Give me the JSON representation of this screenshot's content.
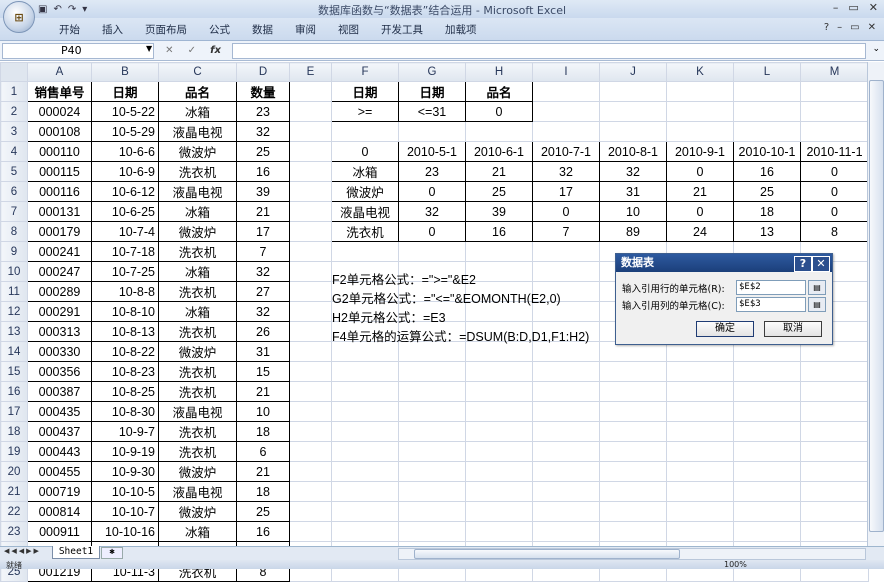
{
  "window": {
    "title": "数据库函数与“数据表”结合运用 - Microsoft Excel",
    "controls": [
      "–",
      "▭",
      "✕"
    ]
  },
  "ribbon": {
    "tabs": [
      "开始",
      "插入",
      "页面布局",
      "公式",
      "数据",
      "审阅",
      "视图",
      "开发工具",
      "加载项"
    ]
  },
  "formula_bar": {
    "name_box": "P40",
    "fx": "fx",
    "content": ""
  },
  "columns": [
    "A",
    "B",
    "C",
    "D",
    "E",
    "F",
    "G",
    "H",
    "I",
    "J",
    "K",
    "L",
    "M"
  ],
  "rows": [
    [
      "销售单号",
      "日期",
      "品名",
      "数量",
      "",
      "日期",
      "日期",
      "品名",
      "",
      "",
      "",
      "",
      ""
    ],
    [
      "000024",
      "10-5-22",
      "冰箱",
      "23",
      "",
      ">=",
      "<=31",
      "0",
      "",
      "",
      "",
      "",
      ""
    ],
    [
      "000108",
      "10-5-29",
      "液晶电视",
      "32",
      "",
      "",
      "",
      "",
      "",
      "",
      "",
      "",
      ""
    ],
    [
      "000110",
      "10-6-6",
      "微波炉",
      "25",
      "",
      "0",
      "2010-5-1",
      "2010-6-1",
      "2010-7-1",
      "2010-8-1",
      "2010-9-1",
      "2010-10-1",
      "2010-11-1"
    ],
    [
      "000115",
      "10-6-9",
      "洗衣机",
      "16",
      "",
      "冰箱",
      "23",
      "21",
      "32",
      "32",
      "0",
      "16",
      "0"
    ],
    [
      "000116",
      "10-6-12",
      "液晶电视",
      "39",
      "",
      "微波炉",
      "0",
      "25",
      "17",
      "31",
      "21",
      "25",
      "0"
    ],
    [
      "000131",
      "10-6-25",
      "冰箱",
      "21",
      "",
      "液晶电视",
      "32",
      "39",
      "0",
      "10",
      "0",
      "18",
      "0"
    ],
    [
      "000179",
      "10-7-4",
      "微波炉",
      "17",
      "",
      "洗衣机",
      "0",
      "16",
      "7",
      "89",
      "24",
      "13",
      "8"
    ],
    [
      "000241",
      "10-7-18",
      "洗衣机",
      "7",
      "",
      "",
      "",
      "",
      "",
      "",
      "",
      "",
      ""
    ],
    [
      "000247",
      "10-7-25",
      "冰箱",
      "32",
      "",
      "",
      "",
      "",
      "",
      "",
      "",
      "",
      ""
    ],
    [
      "000289",
      "10-8-8",
      "洗衣机",
      "27",
      "",
      "",
      "",
      "",
      "",
      "",
      "",
      "",
      ""
    ],
    [
      "000291",
      "10-8-10",
      "冰箱",
      "32",
      "",
      "",
      "",
      "",
      "",
      "",
      "",
      "",
      ""
    ],
    [
      "000313",
      "10-8-13",
      "洗衣机",
      "26",
      "",
      "",
      "",
      "",
      "",
      "",
      "",
      "",
      ""
    ],
    [
      "000330",
      "10-8-22",
      "微波炉",
      "31",
      "",
      "",
      "",
      "",
      "",
      "",
      "",
      "",
      ""
    ],
    [
      "000356",
      "10-8-23",
      "洗衣机",
      "15",
      "",
      "",
      "",
      "",
      "",
      "",
      "",
      "",
      ""
    ],
    [
      "000387",
      "10-8-25",
      "洗衣机",
      "21",
      "",
      "",
      "",
      "",
      "",
      "",
      "",
      "",
      ""
    ],
    [
      "000435",
      "10-8-30",
      "液晶电视",
      "10",
      "",
      "",
      "",
      "",
      "",
      "",
      "",
      "",
      ""
    ],
    [
      "000437",
      "10-9-7",
      "洗衣机",
      "18",
      "",
      "",
      "",
      "",
      "",
      "",
      "",
      "",
      ""
    ],
    [
      "000443",
      "10-9-19",
      "洗衣机",
      "6",
      "",
      "",
      "",
      "",
      "",
      "",
      "",
      "",
      ""
    ],
    [
      "000455",
      "10-9-30",
      "微波炉",
      "21",
      "",
      "",
      "",
      "",
      "",
      "",
      "",
      "",
      ""
    ],
    [
      "000719",
      "10-10-5",
      "液晶电视",
      "18",
      "",
      "",
      "",
      "",
      "",
      "",
      "",
      "",
      ""
    ],
    [
      "000814",
      "10-10-7",
      "微波炉",
      "25",
      "",
      "",
      "",
      "",
      "",
      "",
      "",
      "",
      ""
    ],
    [
      "000911",
      "10-10-16",
      "冰箱",
      "16",
      "",
      "",
      "",
      "",
      "",
      "",
      "",
      "",
      ""
    ],
    [
      "001111",
      "10-10-27",
      "洗衣机",
      "13",
      "",
      "",
      "",
      "",
      "",
      "",
      "",
      "",
      ""
    ],
    [
      "001219",
      "10-11-3",
      "洗衣机",
      "8",
      "",
      "",
      "",
      "",
      "",
      "",
      "",
      "",
      ""
    ]
  ],
  "notes": [
    "F2单元格公式：=\">=\"&E2",
    "G2单元格公式：=\"<=\"&EOMONTH(E2,0)",
    "H2单元格公式：=E3",
    "F4单元格的运算公式：=DSUM(B:D,D1,F1:H2)"
  ],
  "dialog": {
    "title": "数据表",
    "help": "?",
    "close": "✕",
    "row_label": "输入引用行的单元格(R):",
    "row_value": "$E$2",
    "col_label": "输入引用列的单元格(C):",
    "col_value": "$E$3",
    "ok": "确定",
    "cancel": "取消"
  },
  "sheet_tabs": [
    "Sheet1"
  ],
  "status": {
    "ready": "就绪",
    "zoom": "100%"
  }
}
